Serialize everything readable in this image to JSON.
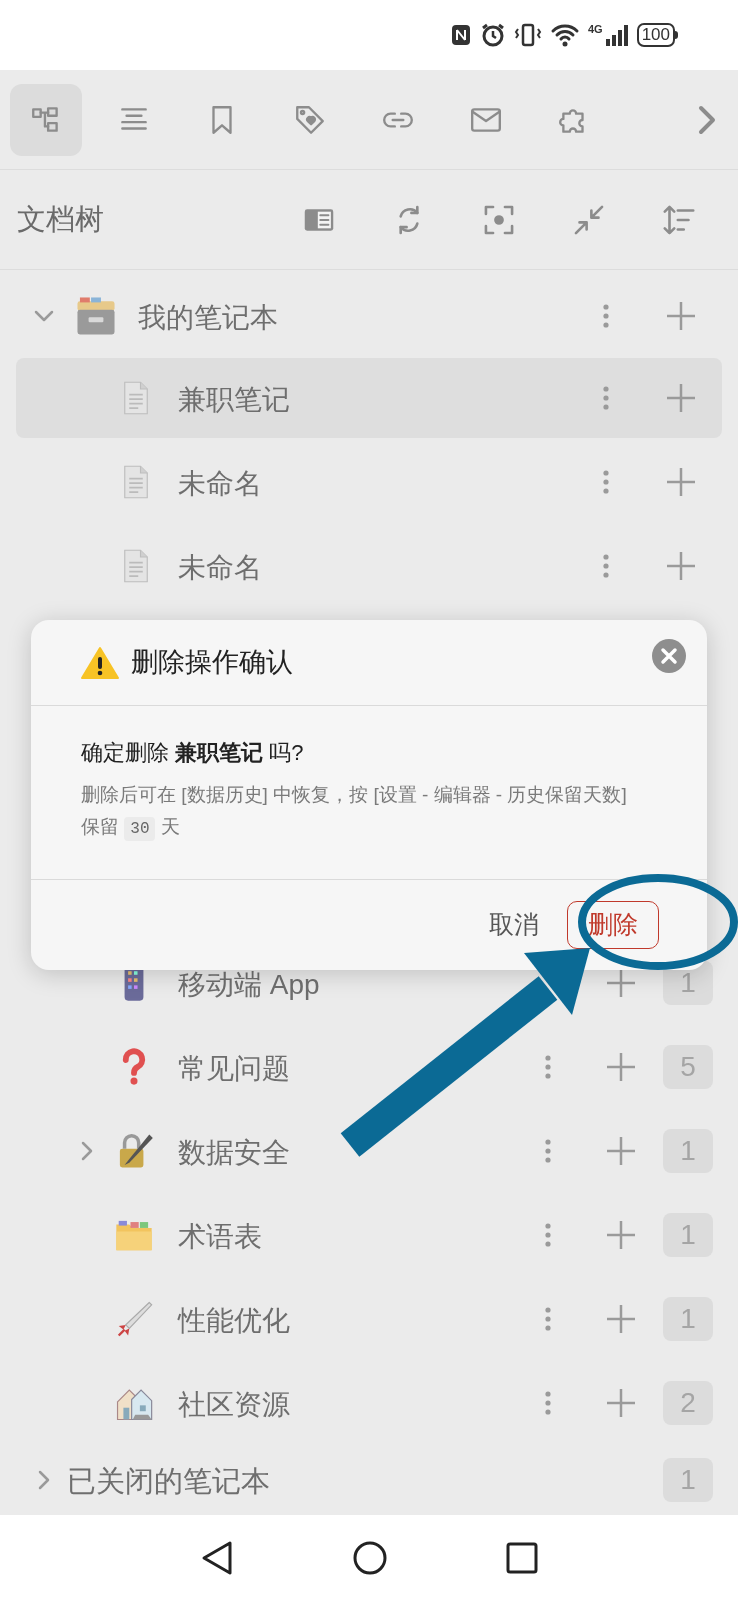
{
  "status_bar": {
    "network": "4G",
    "battery": "100"
  },
  "toolbar": {
    "tabs": [
      {
        "selected": true
      },
      {
        "selected": false
      },
      {
        "selected": false
      },
      {
        "selected": false
      },
      {
        "selected": false
      },
      {
        "selected": false
      },
      {
        "selected": false
      }
    ]
  },
  "panel": {
    "title": "文档树"
  },
  "tree": [
    {
      "label": "我的笔记本",
      "expanded": true,
      "children": [
        {
          "label": "兼职笔记",
          "selected": true
        },
        {
          "label": "未命名",
          "selected": false
        },
        {
          "label": "未命名",
          "selected": false
        }
      ]
    }
  ],
  "lower_rows": [
    {
      "label": "移动端 App",
      "expandable": false,
      "menu": false,
      "count": "1"
    },
    {
      "label": "常见问题",
      "expandable": false,
      "menu": true,
      "count": "5"
    },
    {
      "label": "数据安全",
      "expandable": true,
      "menu": true,
      "count": "1"
    },
    {
      "label": "术语表",
      "expandable": false,
      "menu": true,
      "count": "1"
    },
    {
      "label": "性能优化",
      "expandable": false,
      "menu": true,
      "count": "1"
    },
    {
      "label": "社区资源",
      "expandable": false,
      "menu": true,
      "count": "2"
    }
  ],
  "closed_notebooks": {
    "label": "已关闭的笔记本",
    "count": "1"
  },
  "dialog": {
    "title": "删除操作确认",
    "question": "确定删除 **兼职笔记** 吗?",
    "note_before": "删除后可在 [数据历史] 中恢复，按 [设置 - 编辑器 - 历史保留天数] 保留",
    "note_value": "30",
    "note_after": "天",
    "buttons": [
      {
        "label": "取消",
        "kind": "plain"
      },
      {
        "label": "删除",
        "kind": "danger"
      }
    ]
  }
}
